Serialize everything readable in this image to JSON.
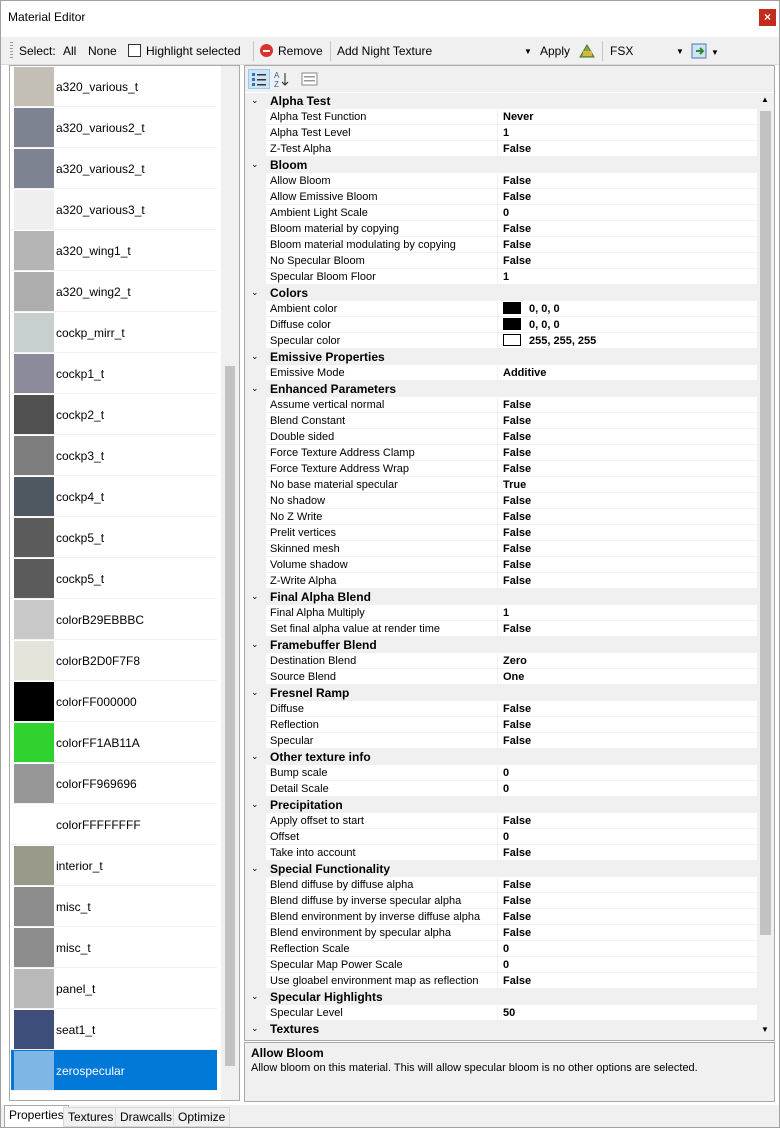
{
  "window": {
    "title": "Material Editor",
    "close_glyph": "×"
  },
  "toolbar": {
    "select_label": "Select:",
    "all": "All",
    "none": "None",
    "highlight_selected": "Highlight selected",
    "remove": "Remove",
    "add_texture": "Add Night Texture",
    "apply": "Apply",
    "sim": "FSX"
  },
  "materials": [
    {
      "name": "a320_various_t",
      "thumb": "#c4bfb5"
    },
    {
      "name": "a320_various2_t",
      "thumb": "#7d8391"
    },
    {
      "name": "a320_various2_t",
      "thumb": "#7d8391"
    },
    {
      "name": "a320_various3_t",
      "thumb": "#efefef"
    },
    {
      "name": "a320_wing1_t",
      "thumb": "#b5b5b5"
    },
    {
      "name": "a320_wing2_t",
      "thumb": "#aeaeae"
    },
    {
      "name": "cockp_mirr_t",
      "thumb": "#c8d0cf"
    },
    {
      "name": "cockp1_t",
      "thumb": "#8b8b9b"
    },
    {
      "name": "cockp2_t",
      "thumb": "#505050"
    },
    {
      "name": "cockp3_t",
      "thumb": "#7d7d7d"
    },
    {
      "name": "cockp4_t",
      "thumb": "#4f5760"
    },
    {
      "name": "cockp5_t",
      "thumb": "#5b5b5b"
    },
    {
      "name": "cockp5_t",
      "thumb": "#5b5b5b"
    },
    {
      "name": "colorB29EBBBC",
      "thumb": "#c8c8c8"
    },
    {
      "name": "colorB2D0F7F8",
      "thumb": "#e4e4da"
    },
    {
      "name": "colorFF000000",
      "thumb": "#000000"
    },
    {
      "name": "colorFF1AB11A",
      "thumb": "#2fd22f"
    },
    {
      "name": "colorFF969696",
      "thumb": "#969696"
    },
    {
      "name": "colorFFFFFFFF",
      "thumb": "#ffffff"
    },
    {
      "name": "interior_t",
      "thumb": "#9a9a8a"
    },
    {
      "name": "misc_t",
      "thumb": "#8c8c8c"
    },
    {
      "name": "misc_t",
      "thumb": "#8c8c8c"
    },
    {
      "name": "panel_t",
      "thumb": "#b9b9b9"
    },
    {
      "name": "seat1_t",
      "thumb": "#3d4f7a"
    },
    {
      "name": "zerospecular",
      "thumb": "#7fb6e6"
    }
  ],
  "property_rows": [
    {
      "cat": "Alpha Test"
    },
    {
      "name": "Alpha Test Function",
      "value": "Never"
    },
    {
      "name": "Alpha Test Level",
      "value": "1"
    },
    {
      "name": "Z-Test Alpha",
      "value": "False"
    },
    {
      "cat": "Bloom"
    },
    {
      "name": "Allow Bloom",
      "value": "False"
    },
    {
      "name": "Allow Emissive Bloom",
      "value": "False"
    },
    {
      "name": "Ambient Light Scale",
      "value": "0"
    },
    {
      "name": "Bloom material by copying",
      "value": "False"
    },
    {
      "name": "Bloom material modulating by copying",
      "value": "False"
    },
    {
      "name": "No Specular Bloom",
      "value": "False"
    },
    {
      "name": "Specular Bloom Floor",
      "value": "1"
    },
    {
      "cat": "Colors"
    },
    {
      "name": "Ambient color",
      "value": "0, 0, 0",
      "swatch": "#000000"
    },
    {
      "name": "Diffuse color",
      "value": "0, 0, 0",
      "swatch": "#000000"
    },
    {
      "name": "Specular color",
      "value": "255, 255, 255",
      "swatch": "#ffffff"
    },
    {
      "cat": "Emissive Properties"
    },
    {
      "name": "Emissive Mode",
      "value": "Additive"
    },
    {
      "cat": "Enhanced Parameters"
    },
    {
      "name": "Assume vertical normal",
      "value": "False"
    },
    {
      "name": "Blend Constant",
      "value": "False"
    },
    {
      "name": "Double sided",
      "value": "False"
    },
    {
      "name": "Force Texture Address Clamp",
      "value": "False"
    },
    {
      "name": "Force Texture Address Wrap",
      "value": "False"
    },
    {
      "name": "No base material specular",
      "value": "True"
    },
    {
      "name": "No shadow",
      "value": "False"
    },
    {
      "name": "No Z Write",
      "value": "False"
    },
    {
      "name": "Prelit vertices",
      "value": "False"
    },
    {
      "name": "Skinned mesh",
      "value": "False"
    },
    {
      "name": "Volume shadow",
      "value": "False"
    },
    {
      "name": "Z-Write Alpha",
      "value": "False"
    },
    {
      "cat": "Final Alpha Blend"
    },
    {
      "name": "Final Alpha Multiply",
      "value": "1"
    },
    {
      "name": "Set final alpha value at render time",
      "value": "False"
    },
    {
      "cat": "Framebuffer Blend"
    },
    {
      "name": "Destination Blend",
      "value": "Zero"
    },
    {
      "name": "Source Blend",
      "value": "One"
    },
    {
      "cat": "Fresnel Ramp"
    },
    {
      "name": "Diffuse",
      "value": "False"
    },
    {
      "name": "Reflection",
      "value": "False"
    },
    {
      "name": "Specular",
      "value": "False"
    },
    {
      "cat": "Other texture info"
    },
    {
      "name": "Bump scale",
      "value": "0"
    },
    {
      "name": "Detail Scale",
      "value": "0"
    },
    {
      "cat": "Precipitation"
    },
    {
      "name": "Apply offset to start",
      "value": "False"
    },
    {
      "name": "Offset",
      "value": "0"
    },
    {
      "name": "Take into account",
      "value": "False"
    },
    {
      "cat": "Special Functionality"
    },
    {
      "name": "Blend diffuse by diffuse alpha",
      "value": "False"
    },
    {
      "name": "Blend diffuse by inverse specular alpha",
      "value": "False"
    },
    {
      "name": "Blend environment by inverse diffuse alpha",
      "value": "False"
    },
    {
      "name": "Blend environment by specular alpha",
      "value": "False"
    },
    {
      "name": "Reflection Scale",
      "value": "0"
    },
    {
      "name": "Specular Map Power Scale",
      "value": "0"
    },
    {
      "name": "Use gloabel environment map as reflection",
      "value": "False"
    },
    {
      "cat": "Specular Highlights"
    },
    {
      "name": "Specular Level",
      "value": "50"
    },
    {
      "cat": "Textures"
    }
  ],
  "description": {
    "title": "Allow Bloom",
    "text": "Allow bloom on this material. This will allow specular bloom is no other options are selected."
  },
  "tabs": [
    "Properties",
    "Textures",
    "Drawcalls",
    "Optimize"
  ]
}
